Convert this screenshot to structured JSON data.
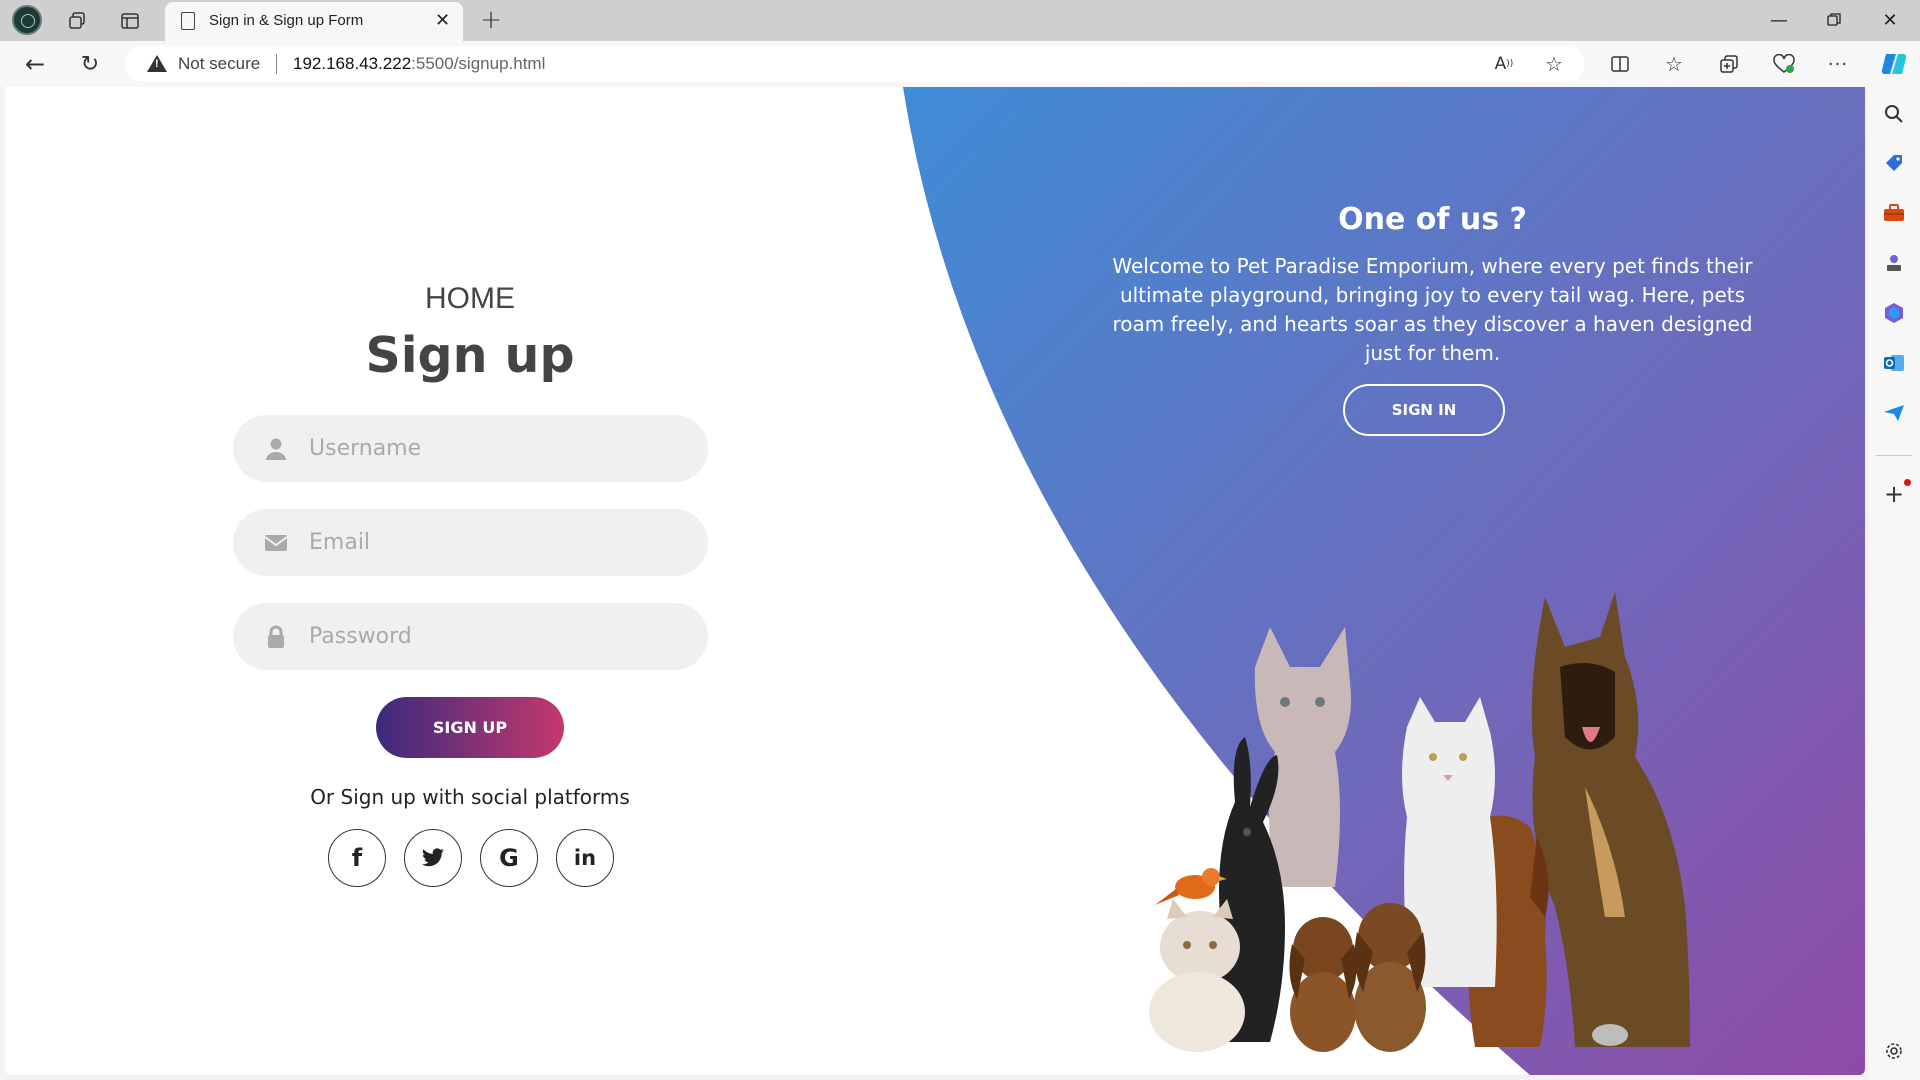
{
  "browser": {
    "tab_title": "Sign in & Sign up Form",
    "address": {
      "security_label": "Not secure",
      "url_host": "192.168.43.222",
      "url_rest": ":5500/signup.html"
    }
  },
  "signup": {
    "home_label": "HOME",
    "title": "Sign up",
    "username_placeholder": "Username",
    "email_placeholder": "Email",
    "password_placeholder": "Password",
    "button_label": "SIGN UP",
    "social_text": "Or Sign up with social platforms",
    "social": [
      "f",
      "𝕥",
      "G",
      "in"
    ]
  },
  "panel": {
    "title": "One of us ?",
    "text": "Welcome to Pet Paradise Emporium, where every pet finds their ultimate playground, bringing joy to every tail wag. Here, pets roam freely, and hearts soar as they discover a haven designed just for them.",
    "button_label": "SIGN IN"
  },
  "colors": {
    "gradient_start": "#3f8cd6",
    "gradient_end": "#8f4aa6",
    "signup_btn_start": "#3a2a7d",
    "signup_btn_end": "#c4386c"
  },
  "icons": [
    "user-icon",
    "envelope-icon",
    "lock-icon",
    "facebook-icon",
    "twitter-icon",
    "google-icon",
    "linkedin-icon"
  ]
}
